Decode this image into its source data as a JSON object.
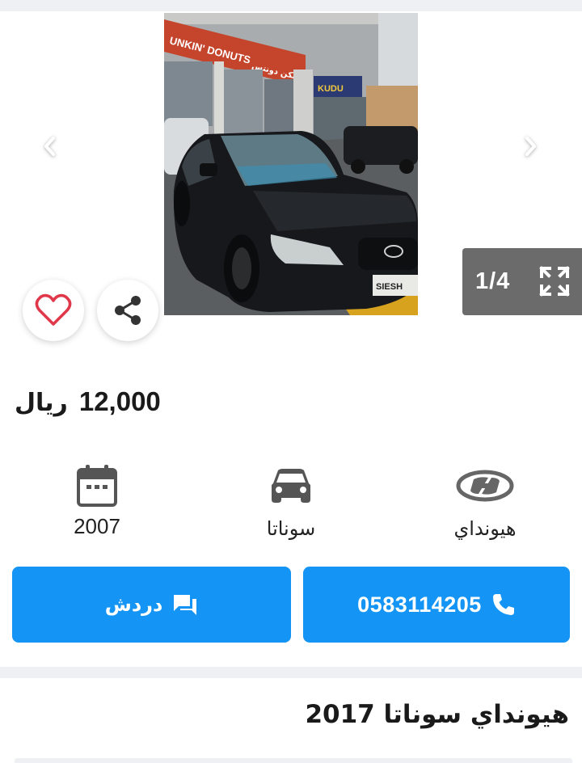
{
  "gallery": {
    "counter": "1/4",
    "photo_signage": {
      "store_left": "UNKIN' DONUTS",
      "store_left_arabic": "دنكن دونتس",
      "store_right": "KUDU",
      "plate": "SIESH"
    }
  },
  "price": {
    "value": "12,000",
    "currency": "ريال"
  },
  "specs": {
    "year": "2007",
    "model": "سوناتا",
    "make": "هيونداي"
  },
  "actions": {
    "chat_label": "دردش",
    "phone": "0583114205"
  },
  "listing": {
    "title": "هيونداي سوناتا 2017"
  },
  "colors": {
    "accent": "#1495f5",
    "favorite": "#e0384b",
    "counter_bg": "#6b6b6b",
    "section_gap": "#eef0f3"
  },
  "icons": {
    "prev": "chevron-left-icon",
    "next": "chevron-right-icon",
    "expand": "fullscreen-expand-icon",
    "favorite": "heart-outline-icon",
    "share": "share-icon",
    "year": "calendar-icon",
    "model": "car-icon",
    "make": "hyundai-logo-icon",
    "chat": "chat-bubble-icon",
    "call": "phone-icon"
  }
}
